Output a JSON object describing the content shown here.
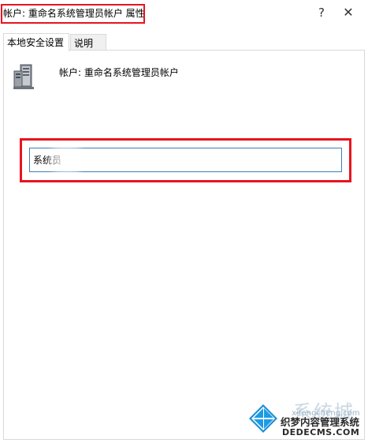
{
  "window": {
    "title": "帐户: 重命名系统管理员帐户 属性",
    "help_glyph": "?",
    "close_glyph": "✕"
  },
  "tabs": [
    {
      "label": "本地安全设置",
      "active": true
    },
    {
      "label": "说明",
      "active": false
    }
  ],
  "panel": {
    "icon": "server-icon",
    "account_label": "帐户: 重命名系统管理员帐户",
    "name_input_value": "系统员"
  },
  "colors": {
    "highlight": "#e8141e",
    "input_border": "#3c7fb1"
  },
  "watermark": {
    "brand_cn": "系统城",
    "brand_en_small": "xitongcheng.com",
    "line_cn": "织梦内容管理系统",
    "line_en": "DEDECMS.COM"
  }
}
